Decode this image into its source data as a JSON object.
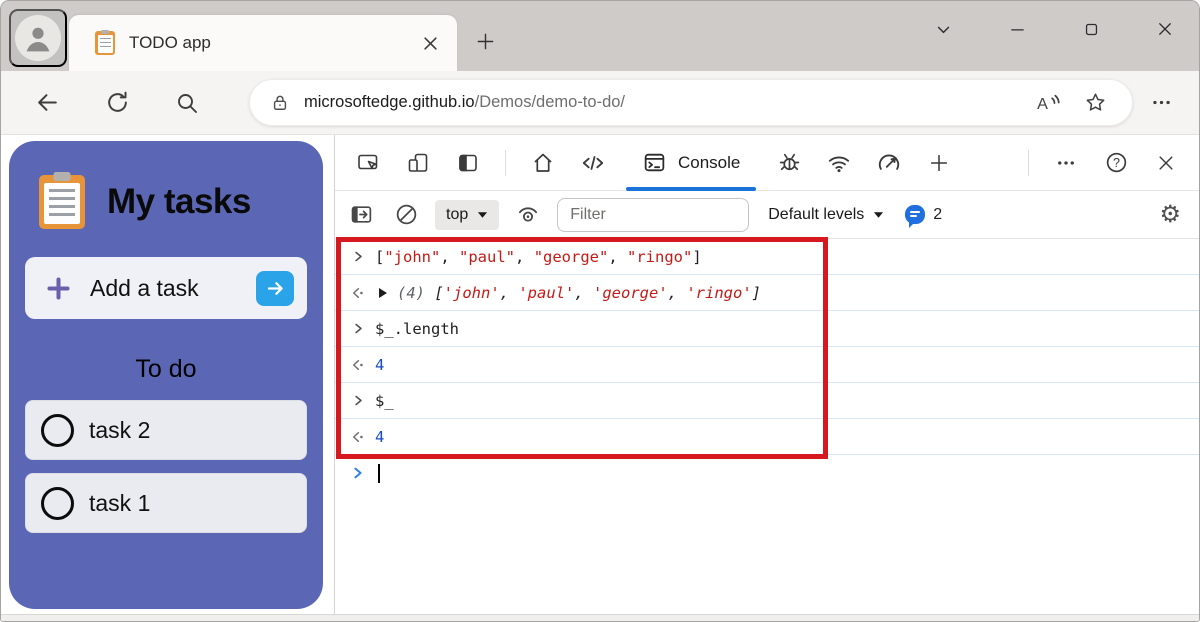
{
  "tab": {
    "title": "TODO app"
  },
  "url": {
    "host": "microsoftedge.github.io",
    "path": "/Demos/demo-to-do/"
  },
  "todo": {
    "title": "My tasks",
    "add_label": "Add a task",
    "section_label": "To do",
    "tasks": [
      {
        "label": "task 2"
      },
      {
        "label": "task 1"
      }
    ]
  },
  "devtools": {
    "console_tab_label": "Console",
    "context_selector": "top",
    "filter_placeholder": "Filter",
    "levels_label": "Default levels",
    "issues_count": "2",
    "console_rows": [
      {
        "kind": "command",
        "tokens": [
          {
            "text": "[",
            "type": "punct"
          },
          {
            "text": "\"john\"",
            "type": "string"
          },
          {
            "text": ", ",
            "type": "punct"
          },
          {
            "text": "\"paul\"",
            "type": "string"
          },
          {
            "text": ", ",
            "type": "punct"
          },
          {
            "text": "\"george\"",
            "type": "string"
          },
          {
            "text": ", ",
            "type": "punct"
          },
          {
            "text": "\"ringo\"",
            "type": "string"
          },
          {
            "text": "]",
            "type": "punct"
          }
        ]
      },
      {
        "kind": "result",
        "expandable": true,
        "italic": true,
        "tokens": [
          {
            "text": "(4) ",
            "type": "paren"
          },
          {
            "text": "[",
            "type": "punct"
          },
          {
            "text": "'john'",
            "type": "string"
          },
          {
            "text": ", ",
            "type": "punct"
          },
          {
            "text": "'paul'",
            "type": "string"
          },
          {
            "text": ", ",
            "type": "punct"
          },
          {
            "text": "'george'",
            "type": "string"
          },
          {
            "text": ", ",
            "type": "punct"
          },
          {
            "text": "'ringo'",
            "type": "string"
          },
          {
            "text": "]",
            "type": "punct"
          }
        ]
      },
      {
        "kind": "command",
        "tokens": [
          {
            "text": "$_.length",
            "type": "punct"
          }
        ]
      },
      {
        "kind": "result",
        "tokens": [
          {
            "text": "4",
            "type": "number"
          }
        ]
      },
      {
        "kind": "command",
        "tokens": [
          {
            "text": "$_",
            "type": "punct"
          }
        ]
      },
      {
        "kind": "result",
        "tokens": [
          {
            "text": "4",
            "type": "number"
          }
        ]
      }
    ]
  },
  "colors": {
    "accent_blue": "#1a73d8",
    "highlight_red": "#d6191f",
    "string_red": "#c41a16",
    "number_blue": "#1a49c8",
    "todo_purple": "#5b67b5",
    "add_button_blue": "#2aa3e8"
  }
}
